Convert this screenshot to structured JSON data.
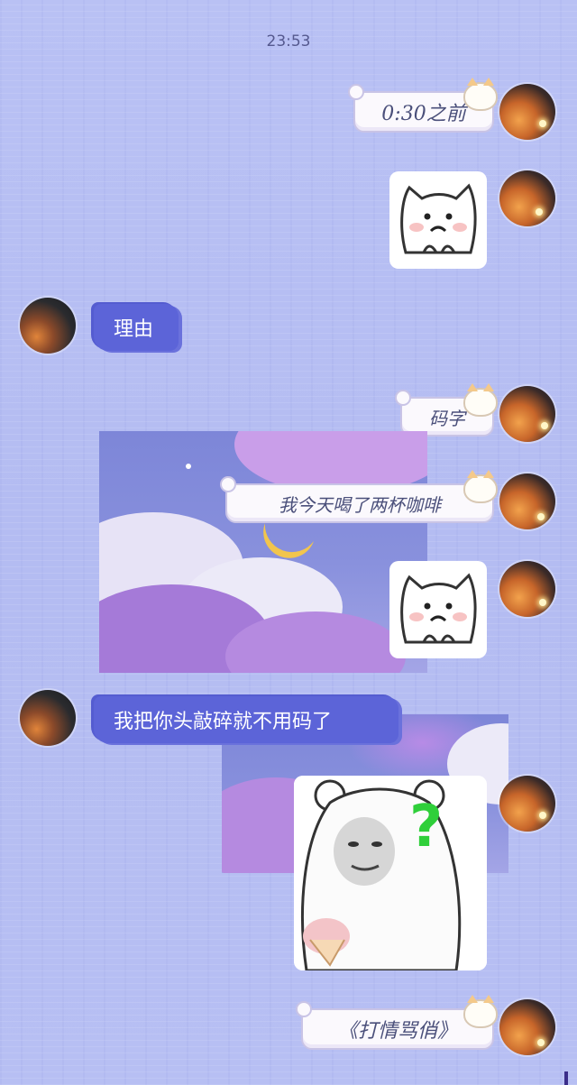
{
  "chat": {
    "timestamp": "23:53",
    "messages": [
      {
        "sender": "self",
        "type": "text",
        "style": "cat-bubble",
        "text": "0:30之前"
      },
      {
        "sender": "self",
        "type": "sticker",
        "description": "cat-sad-sticker"
      },
      {
        "sender": "other",
        "type": "text",
        "style": "brush-bubble",
        "text": "理由"
      },
      {
        "sender": "self",
        "type": "text",
        "style": "cat-bubble",
        "text": "码字"
      },
      {
        "sender": "self",
        "type": "text",
        "style": "cat-bubble",
        "text": "我今天喝了两杯咖啡"
      },
      {
        "sender": "self",
        "type": "sticker",
        "description": "cat-sad-sticker"
      },
      {
        "sender": "other",
        "type": "text",
        "style": "brush-bubble",
        "text": "我把你头敲碎就不用码了"
      },
      {
        "sender": "self",
        "type": "sticker",
        "description": "bear-question-sticker",
        "overlay_text": "?"
      },
      {
        "sender": "self",
        "type": "text",
        "style": "cat-bubble",
        "text": "《打情骂俏》"
      }
    ]
  },
  "colors": {
    "background": "#b7bff3",
    "brush_bubble": "#5c64d8",
    "cat_bubble": "#fbf9fd",
    "question_mark": "#2fcf3a"
  }
}
